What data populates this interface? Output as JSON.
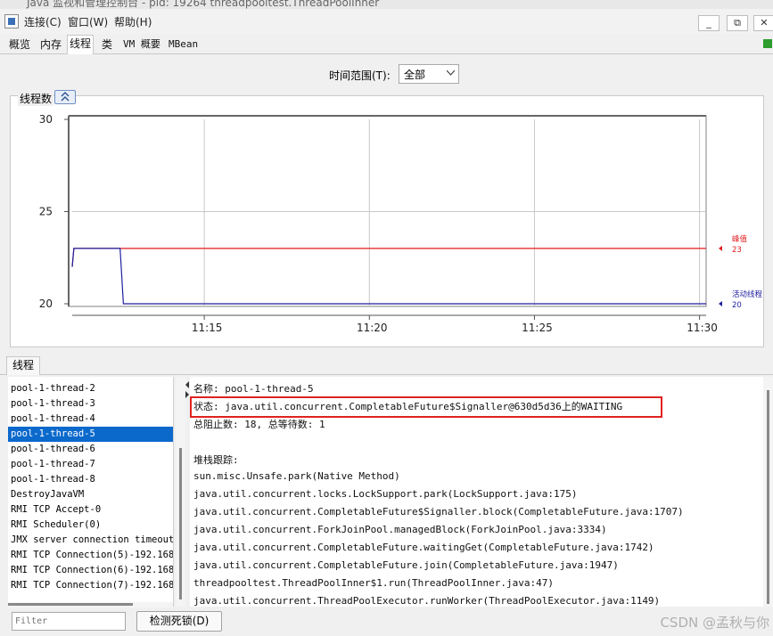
{
  "window": {
    "title": "Java 监视和管理控制台 - pid: 19264 threadpooltest.ThreadPoolInner"
  },
  "menu": {
    "items": [
      "连接(C)",
      "窗口(W)",
      "帮助(H)"
    ],
    "win_buttons": [
      "_",
      "⧉",
      "✕"
    ]
  },
  "tabs": [
    {
      "label": "概览"
    },
    {
      "label": "内存"
    },
    {
      "label": "线程",
      "active": true
    },
    {
      "label": "类"
    },
    {
      "label": "VM 概要"
    },
    {
      "label": "MBean"
    }
  ],
  "time_range": {
    "label": "时间范围(T):",
    "selected": "全部"
  },
  "chart_section": {
    "title": "线程数"
  },
  "chart_data": {
    "type": "line",
    "title": "",
    "ylim": [
      20,
      30
    ],
    "y_ticks": [
      30,
      25,
      20
    ],
    "x_ticks": [
      "11:15",
      "11:20",
      "11:25",
      "11:30"
    ],
    "x_unit": "minutes since 11:10",
    "x_range": [
      1.0,
      20.2
    ],
    "grid": true,
    "series": [
      {
        "name": "峰值",
        "color": "#e31a1c",
        "points": [
          [
            1.0,
            22
          ],
          [
            1.05,
            23
          ],
          [
            20.2,
            23
          ]
        ],
        "end_label": "23"
      },
      {
        "name": "活动线程",
        "color": "#1f1fa0",
        "points": [
          [
            1.0,
            22
          ],
          [
            1.05,
            23
          ],
          [
            2.45,
            23
          ],
          [
            2.55,
            20
          ],
          [
            20.2,
            20
          ]
        ],
        "end_label": "20"
      }
    ]
  },
  "threads_tab": {
    "label": "线程"
  },
  "thread_list": [
    "pool-1-thread-2",
    "pool-1-thread-3",
    "pool-1-thread-4",
    "pool-1-thread-5",
    "pool-1-thread-6",
    "pool-1-thread-7",
    "pool-1-thread-8",
    "DestroyJavaVM",
    "RMI TCP Accept-0",
    "RMI Scheduler(0)",
    "JMX server connection timeout",
    "RMI TCP Connection(5)-192.168.",
    "RMI TCP Connection(6)-192.168.",
    "RMI TCP Connection(7)-192.168."
  ],
  "selected_thread_index": 3,
  "detail": {
    "lines": [
      "名称: pool-1-thread-5",
      "状态: java.util.concurrent.CompletableFuture$Signaller@630d5d36上的WAITING",
      "总阻止数: 18, 总等待数: 1",
      "",
      "堆栈跟踪:",
      "sun.misc.Unsafe.park(Native Method)",
      "java.util.concurrent.locks.LockSupport.park(LockSupport.java:175)",
      "java.util.concurrent.CompletableFuture$Signaller.block(CompletableFuture.java:1707)",
      "java.util.concurrent.ForkJoinPool.managedBlock(ForkJoinPool.java:3334)",
      "java.util.concurrent.CompletableFuture.waitingGet(CompletableFuture.java:1742)",
      "java.util.concurrent.CompletableFuture.join(CompletableFuture.java:1947)",
      "threadpooltest.ThreadPoolInner$1.run(ThreadPoolInner.java:47)",
      "java.util.concurrent.ThreadPoolExecutor.runWorker(ThreadPoolExecutor.java:1149)"
    ]
  },
  "filter": {
    "placeholder": "Filter"
  },
  "detect_deadlock": {
    "label": "检测死锁(D)"
  },
  "watermark": "CSDN @孟秋与你"
}
